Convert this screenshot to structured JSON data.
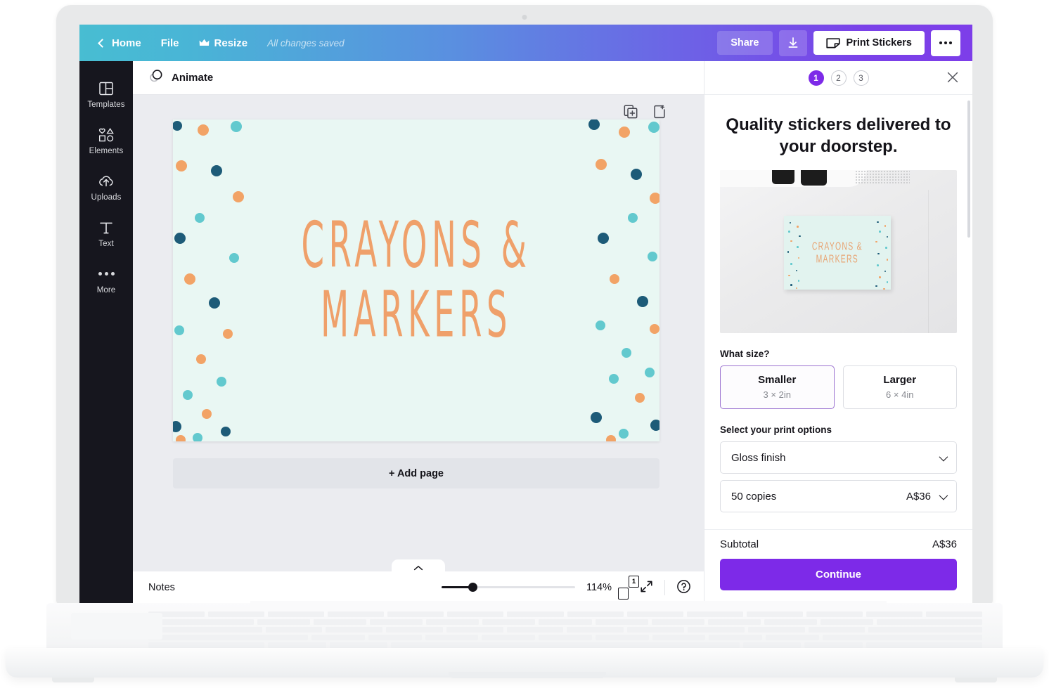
{
  "topbar": {
    "back_label": "Home",
    "file_label": "File",
    "resize_label": "Resize",
    "saved_status": "All changes saved",
    "share_label": "Share",
    "print_label": "Print Stickers",
    "crown_icon": "crown-icon",
    "download_icon": "download-icon",
    "sticker_icon": "sticker-icon",
    "more_icon": "more-horizontal-icon",
    "gradient_start": "#48bdd2",
    "gradient_end": "#7d3ee9"
  },
  "rail": {
    "items": [
      {
        "label": "Templates",
        "icon": "templates-icon"
      },
      {
        "label": "Elements",
        "icon": "elements-icon"
      },
      {
        "label": "Uploads",
        "icon": "uploads-icon"
      },
      {
        "label": "Text",
        "icon": "text-icon"
      },
      {
        "label": "More",
        "icon": "more-icon"
      }
    ]
  },
  "editor": {
    "animate_label": "Animate",
    "animate_icon": "animate-icon",
    "duplicate_icon": "duplicate-page-icon",
    "add_page_icon": "add-page-icon",
    "add_page_label": "+ Add page",
    "canvas": {
      "background": "#e9f7f3",
      "text_line_1": "CRAYONS &",
      "text_line_2": "MARKERS",
      "text_color": "#efa06a",
      "dot_colors": {
        "orange": "#f2a366",
        "teal": "#62c9ce",
        "navy": "#1d5b78"
      }
    }
  },
  "bottombar": {
    "notes_label": "Notes",
    "zoom_level": "114%",
    "page_number": "1",
    "collapse_icon": "chevron-up-icon",
    "pages_icon": "pages-icon",
    "fullscreen_icon": "expand-icon",
    "help_icon": "help-icon"
  },
  "panel": {
    "steps": [
      "1",
      "2",
      "3"
    ],
    "active_step": "1",
    "close_icon": "close-icon",
    "title": "Quality stickers delivered to your doorstep.",
    "preview": {
      "sticker_line_1": "CRAYONS &",
      "sticker_line_2": "MARKERS"
    },
    "size_label": "What size?",
    "size_options": [
      {
        "name": "Smaller",
        "dimensions": "3 × 2in",
        "selected": true
      },
      {
        "name": "Larger",
        "dimensions": "6 × 4in",
        "selected": false
      }
    ],
    "print_options_label": "Select your print options",
    "finish_value": "Gloss finish",
    "copies_value": "50 copies",
    "copies_price": "A$36",
    "subtotal_label": "Subtotal",
    "subtotal_value": "A$36",
    "continue_label": "Continue",
    "accent_color": "#7d2ae8",
    "selected_border": "#9b72d1"
  }
}
